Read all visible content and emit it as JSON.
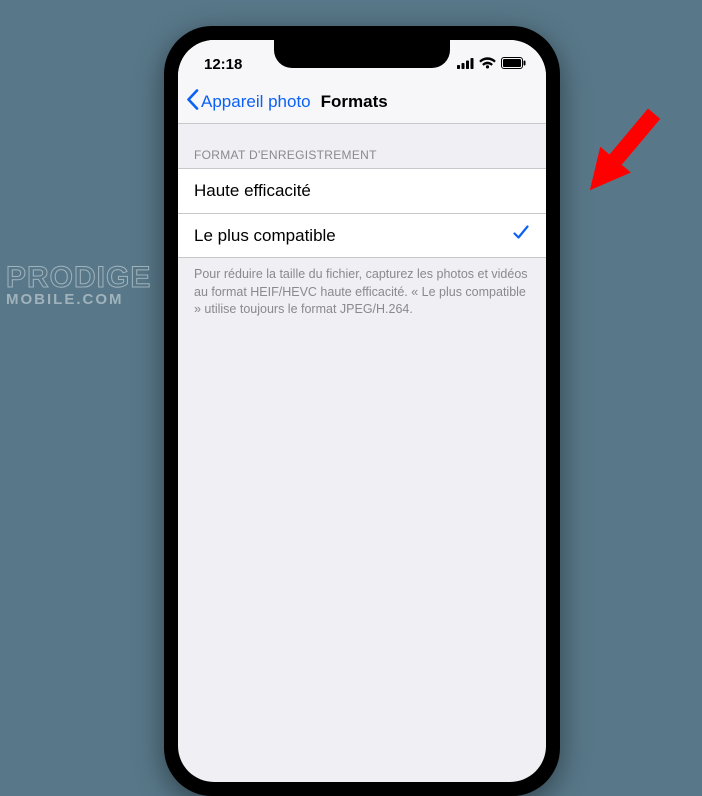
{
  "statusbar": {
    "time": "12:18"
  },
  "navbar": {
    "back_label": "Appareil photo",
    "title": "Formats"
  },
  "section": {
    "header": "FORMAT D'ENREGISTREMENT",
    "options": {
      "high_efficiency": "Haute efficacité",
      "most_compatible": "Le plus compatible"
    },
    "footer": "Pour réduire la taille du fichier, capturez les photos et vidéos au format HEIF/HEVC haute efficacité. « Le plus compatible » utilise toujours le format JPEG/H.264."
  },
  "watermark": {
    "line1": "PRODIGE",
    "line2": "MOBILE.COM"
  }
}
